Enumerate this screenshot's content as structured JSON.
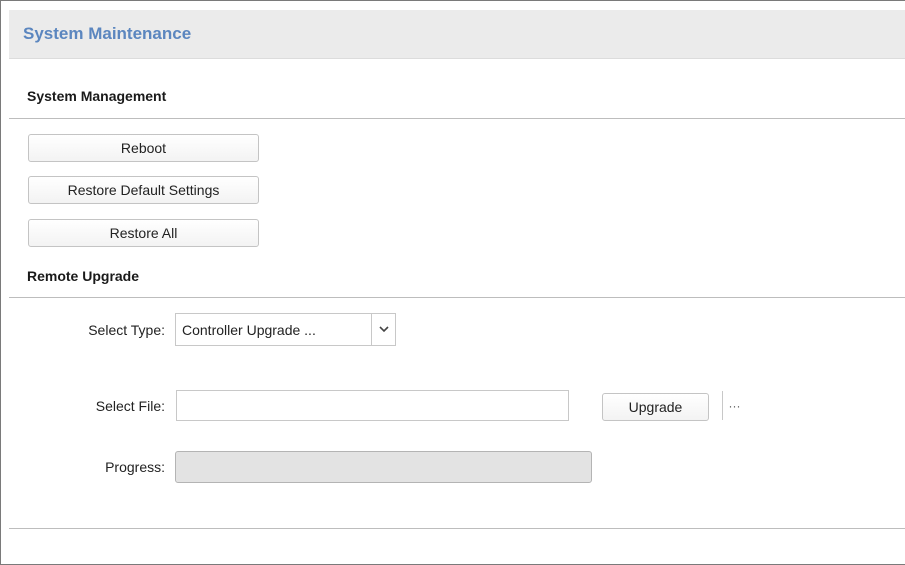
{
  "header": {
    "title": "System Maintenance"
  },
  "system_management": {
    "title": "System Management",
    "buttons": [
      "Reboot",
      "Restore Default Settings",
      "Restore All"
    ]
  },
  "remote_upgrade": {
    "title": "Remote Upgrade",
    "select_type": {
      "label": "Select Type:",
      "value": "Controller Upgrade ..."
    },
    "select_file": {
      "label": "Select File:",
      "value": "",
      "browse_label": "···",
      "upgrade_label": "Upgrade"
    },
    "progress": {
      "label": "Progress:",
      "fraction": 0
    }
  }
}
